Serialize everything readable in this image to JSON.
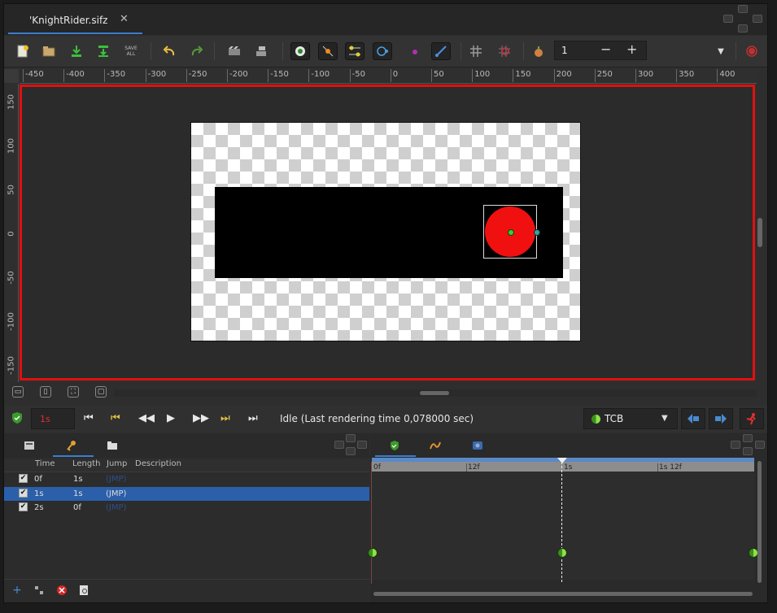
{
  "document": {
    "tab_title": "'KnightRider.sifz",
    "close_glyph": "✕"
  },
  "toolbar": {
    "buttons": [
      "new-file-icon",
      "open-file-icon",
      "save-icon",
      "save-as-icon",
      "save-all-icon",
      "undo-icon",
      "redo-icon",
      "render-icon",
      "preview-icon",
      "toggle-position-ducks-icon",
      "toggle-vertex-ducks-icon",
      "toggle-tangent-ducks-icon",
      "toggle-radius-ducks-icon",
      "toggle-width-ducks-icon",
      "toggle-angle-ducks-icon",
      "toggle-grid-icon",
      "toggle-snap-icon",
      "onion-skin-icon"
    ],
    "save_all_text": "SAVE ALL",
    "frame_value": "1",
    "minus": "−",
    "plus": "+",
    "menu_arrow": "▼"
  },
  "rulers": {
    "horizontal": [
      "-450",
      "-400",
      "-350",
      "-300",
      "-250",
      "-200",
      "-150",
      "-100",
      "-50",
      "0",
      "50",
      "100",
      "150",
      "200",
      "250",
      "300",
      "350",
      "400"
    ],
    "vertical": [
      "150",
      "100",
      "50",
      "0",
      "-50",
      "-100",
      "-150"
    ]
  },
  "transport": {
    "current_time": "1s",
    "status": "Idle (Last rendering time 0,078000 sec)",
    "interpolation": "TCB",
    "buttons": [
      "seek-begin-icon",
      "prev-keyframe-icon",
      "prev-frame-icon",
      "play-icon",
      "next-frame-icon",
      "next-keyframe-icon",
      "seek-end-icon"
    ]
  },
  "keyframes_panel": {
    "columns": [
      "Time",
      "Length",
      "Jump",
      "Description"
    ],
    "rows": [
      {
        "checked": true,
        "time": "0f",
        "length": "1s",
        "jump": "(JMP)",
        "description": "",
        "selected": false
      },
      {
        "checked": true,
        "time": "1s",
        "length": "1s",
        "jump": "(JMP)",
        "description": "",
        "selected": true
      },
      {
        "checked": true,
        "time": "2s",
        "length": "0f",
        "jump": "(JMP)",
        "description": "",
        "selected": false
      }
    ]
  },
  "timetrack": {
    "labels": [
      "0f",
      "12f",
      "1s",
      "1s 12f"
    ]
  },
  "colors": {
    "canvas_border": "#e01010",
    "circle": "#f01010",
    "selection": "#2b5faa",
    "accent": "#3a7fd0"
  }
}
